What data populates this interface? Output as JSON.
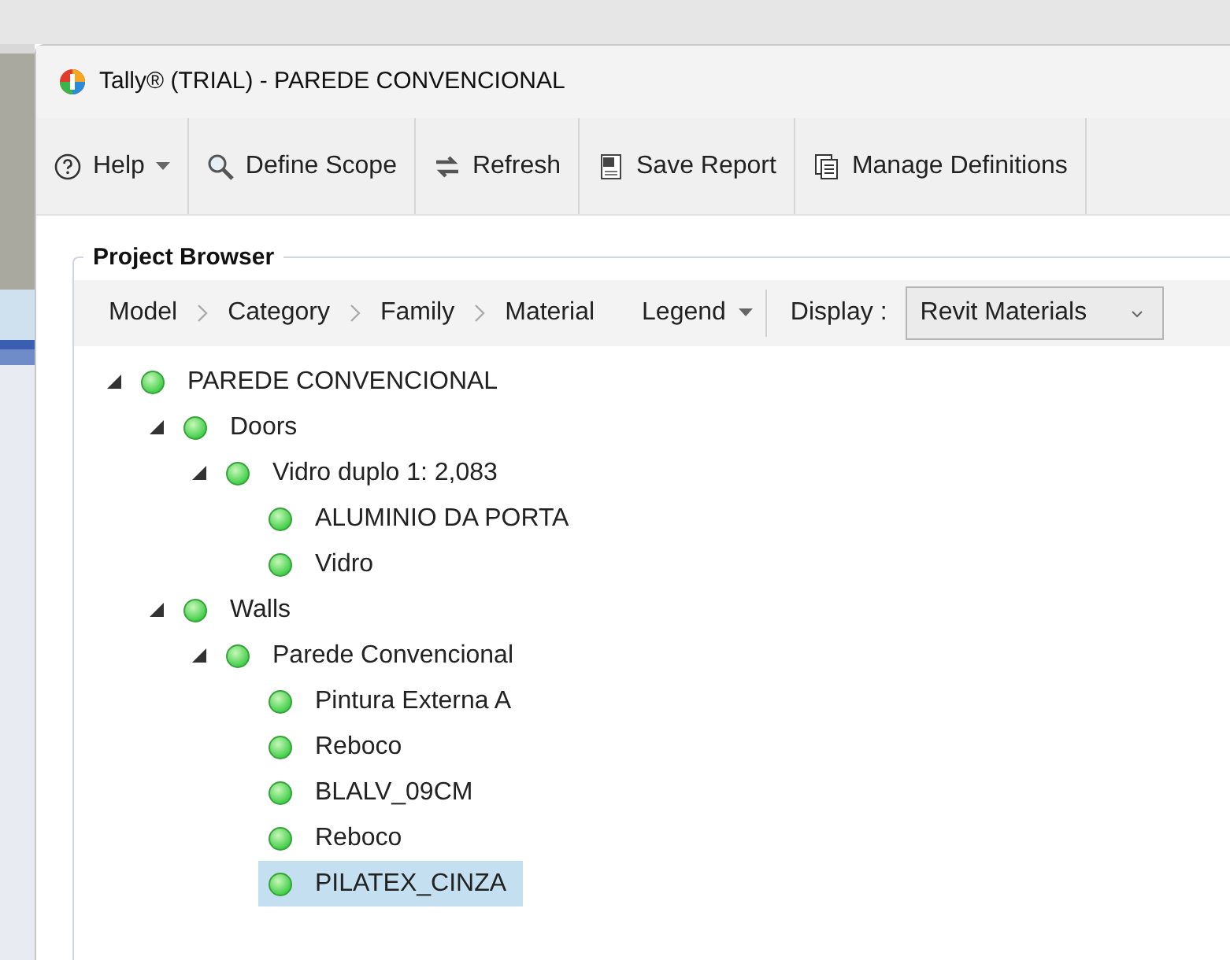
{
  "window": {
    "title": "Tally® (TRIAL) - PAREDE CONVENCIONAL"
  },
  "toolbar": [
    {
      "label": "Help",
      "has_menu": true
    },
    {
      "label": "Define Scope",
      "has_menu": false
    },
    {
      "label": "Refresh",
      "has_menu": false
    },
    {
      "label": "Save Report",
      "has_menu": false
    },
    {
      "label": "Manage Definitions",
      "has_menu": false
    }
  ],
  "project_browser": {
    "title": "Project Browser",
    "breadcrumb": [
      "Model",
      "Category",
      "Family",
      "Material"
    ],
    "legend": {
      "label": "Legend"
    },
    "display": {
      "label": "Display :",
      "value": "Revit Materials"
    },
    "tree": [
      {
        "label": "PAREDE CONVENCIONAL",
        "expanded": true,
        "selected": false,
        "children": [
          {
            "label": "Doors",
            "expanded": true,
            "selected": false,
            "children": [
              {
                "label": "Vidro duplo 1: 2,083",
                "expanded": true,
                "selected": false,
                "children": [
                  {
                    "label": "ALUMINIO DA PORTA",
                    "selected": false
                  },
                  {
                    "label": "Vidro",
                    "selected": false
                  }
                ]
              }
            ]
          },
          {
            "label": "Walls",
            "expanded": true,
            "selected": false,
            "children": [
              {
                "label": "Parede Convencional",
                "expanded": true,
                "selected": false,
                "children": [
                  {
                    "label": "Pintura Externa A",
                    "selected": false
                  },
                  {
                    "label": "Reboco",
                    "selected": false
                  },
                  {
                    "label": "BLALV_09CM",
                    "selected": false
                  },
                  {
                    "label": "Reboco",
                    "selected": false
                  },
                  {
                    "label": "PILATEX_CINZA",
                    "selected": true
                  }
                ]
              }
            ]
          }
        ]
      }
    ]
  }
}
